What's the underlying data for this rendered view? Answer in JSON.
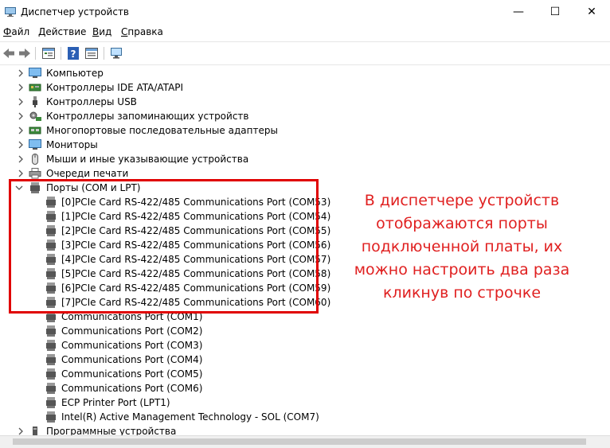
{
  "window": {
    "title": "Диспетчер устройств",
    "min": "—",
    "max": "☐",
    "close": "✕"
  },
  "menu": [
    {
      "pre": "",
      "u": "Ф",
      "post": "айл"
    },
    {
      "pre": "",
      "u": "Д",
      "post": "ействие"
    },
    {
      "pre": "",
      "u": "В",
      "post": "ид"
    },
    {
      "pre": "",
      "u": "С",
      "post": "правка"
    }
  ],
  "tree": {
    "categories": [
      {
        "label": "Компьютер",
        "icon": "monitor-icon"
      },
      {
        "label": "Контроллеры IDE ATA/ATAPI",
        "icon": "ide-controller-icon"
      },
      {
        "label": "Контроллеры USB",
        "icon": "usb-icon"
      },
      {
        "label": "Контроллеры запоминающих устройств",
        "icon": "storage-controller-icon"
      },
      {
        "label": "Многопортовые последовательные адаптеры",
        "icon": "serial-adapter-icon"
      },
      {
        "label": "Мониторы",
        "icon": "monitor-icon"
      },
      {
        "label": "Мыши и иные указывающие устройства",
        "icon": "mouse-icon"
      },
      {
        "label": "Очереди печати",
        "icon": "printer-icon"
      }
    ],
    "ports": {
      "label": "Порты (COM и LPT)",
      "items": [
        "[0]PCIe Card RS-422/485 Communications Port (COM53)",
        "[1]PCIe Card RS-422/485 Communications Port (COM54)",
        "[2]PCIe Card RS-422/485 Communications Port (COM55)",
        "[3]PCIe Card RS-422/485 Communications Port (COM56)",
        "[4]PCIe Card RS-422/485 Communications Port (COM57)",
        "[5]PCIe Card RS-422/485 Communications Port (COM58)",
        "[6]PCIe Card RS-422/485 Communications Port (COM59)",
        "[7]PCIe Card RS-422/485 Communications Port (COM60)",
        "Communications Port (COM1)",
        "Communications Port (COM2)",
        "Communications Port (COM3)",
        "Communications Port (COM4)",
        "Communications Port (COM5)",
        "Communications Port (COM6)",
        "ECP Printer Port (LPT1)",
        "Intel(R) Active Management Technology - SOL (COM7)"
      ]
    },
    "after": {
      "label": "Программные устройства"
    }
  },
  "annotation": "В диспетчере устройств отображаются порты подключенной платы, их можно настроить два раза кликнув по строчке",
  "colors": {
    "highlight": "#e00000",
    "annotation": "#e02020"
  }
}
